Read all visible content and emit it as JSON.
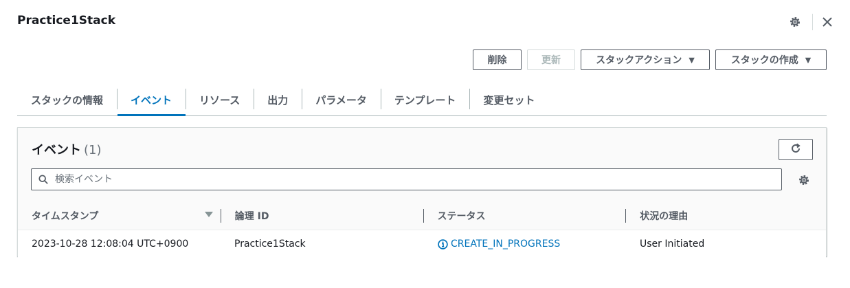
{
  "header": {
    "title": "Practice1Stack"
  },
  "toolbar": {
    "delete_label": "削除",
    "update_label": "更新",
    "stack_actions_label": "スタックアクション",
    "create_stack_label": "スタックの作成",
    "caret": "▼"
  },
  "tabs": [
    {
      "label": "スタックの情報"
    },
    {
      "label": "イベント"
    },
    {
      "label": "リソース"
    },
    {
      "label": "出力"
    },
    {
      "label": "パラメータ"
    },
    {
      "label": "テンプレート"
    },
    {
      "label": "変更セット"
    }
  ],
  "events": {
    "title": "イベント",
    "count": "(1)",
    "search_placeholder": "検索イベント",
    "columns": [
      "タイムスタンプ",
      "論理 ID",
      "ステータス",
      "状況の理由"
    ],
    "rows": [
      {
        "timestamp": "2023-10-28 12:08:04 UTC+0900",
        "logical_id": "Practice1Stack",
        "status": "CREATE_IN_PROGRESS",
        "reason": "User Initiated"
      }
    ]
  },
  "colors": {
    "accent": "#0073bb",
    "text": "#16191f",
    "muted": "#545b64",
    "disabled": "#aab7b8"
  },
  "icons": {
    "settings": "gear-icon",
    "close": "close-icon",
    "refresh": "refresh-icon",
    "search": "search-icon",
    "info": "info-icon",
    "sort": "sort-down-icon"
  }
}
